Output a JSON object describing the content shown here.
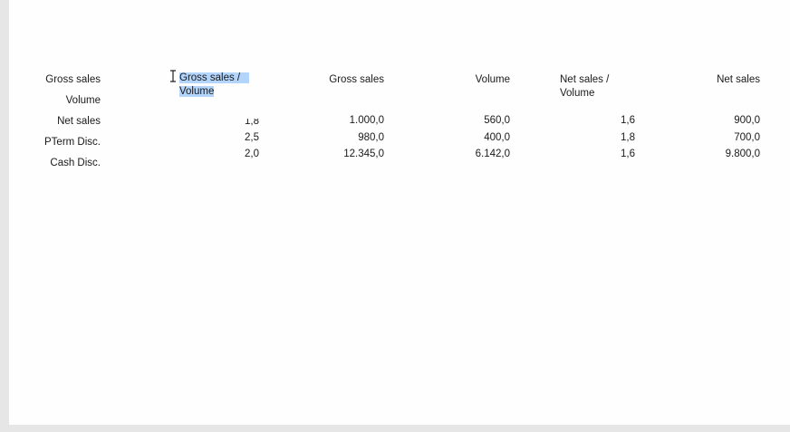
{
  "row_labels": [
    "Gross sales",
    "Volume",
    "Net sales",
    "PTerm Disc.",
    "Cash Disc."
  ],
  "headers": {
    "col1_line1": "Gross sales /",
    "col1_line2": "Volume",
    "col2": "Gross sales",
    "col3": "Volume",
    "col4_line1": "Net sales /",
    "col4_line2": "Volume",
    "col5": "Net sales"
  },
  "rows": [
    [
      "1,8",
      "1.000,0",
      "560,0",
      "1,6",
      "900,0"
    ],
    [
      "2,5",
      "980,0",
      "400,0",
      "1,8",
      "700,0"
    ],
    [
      "2,0",
      "12.345,0",
      "6.142,0",
      "1,6",
      "9.800,0"
    ]
  ]
}
